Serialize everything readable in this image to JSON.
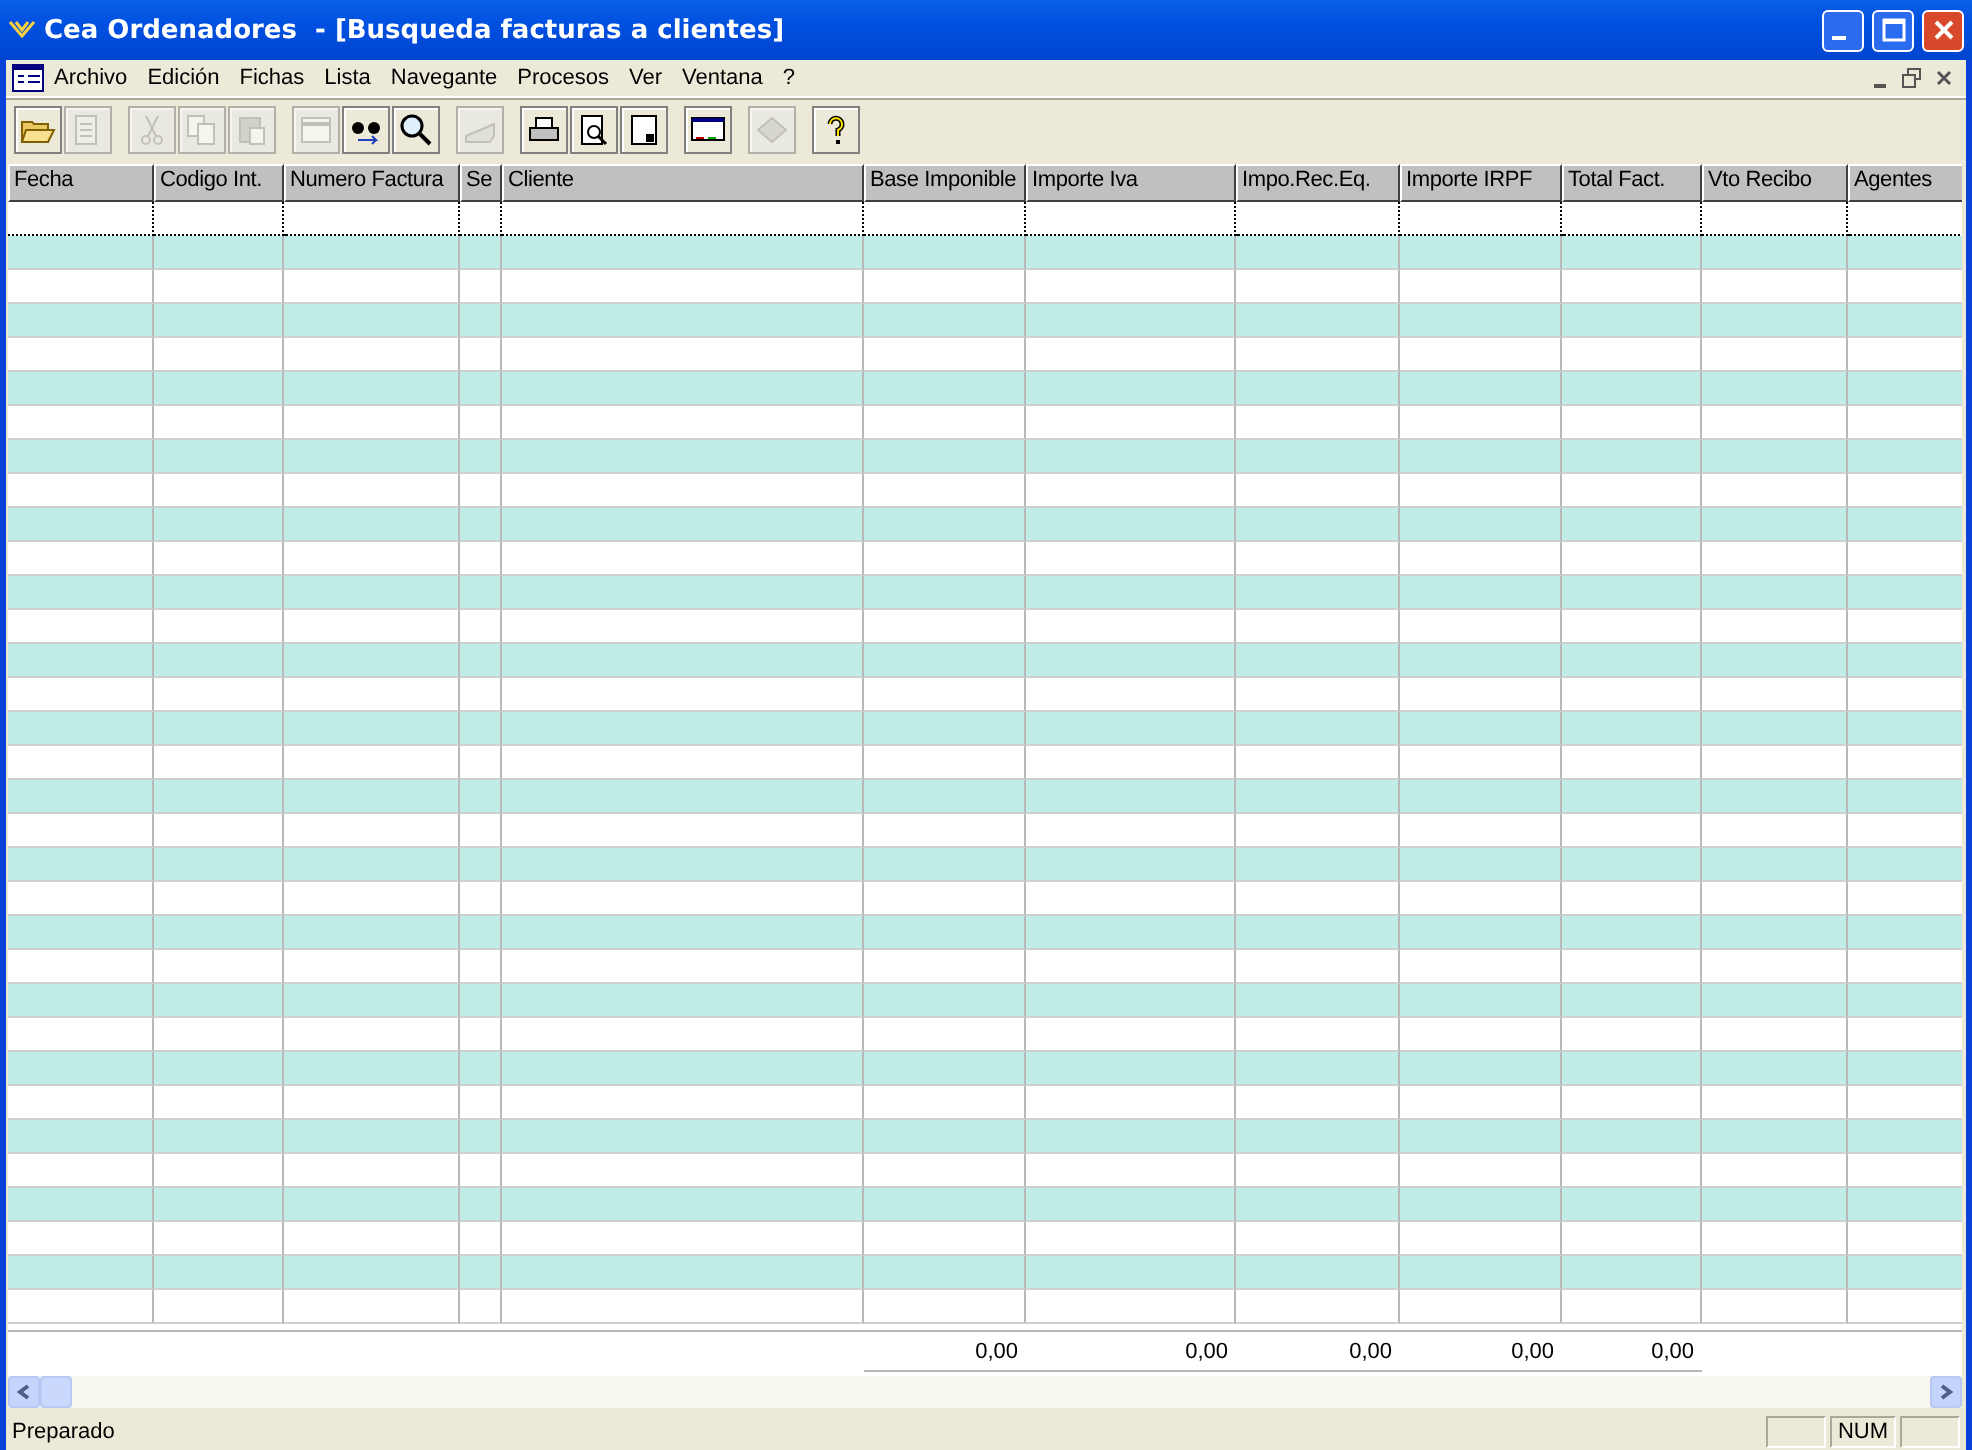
{
  "window": {
    "title": "Cea Ordenadores  - [Busqueda facturas a clientes]"
  },
  "menu": [
    "Archivo",
    "Edición",
    "Fichas",
    "Lista",
    "Navegante",
    "Procesos",
    "Ver",
    "Ventana",
    "?"
  ],
  "toolbar": [
    [
      {
        "kind": "open",
        "disabled": false
      },
      {
        "kind": "edit",
        "disabled": true
      }
    ],
    [
      {
        "kind": "cut",
        "disabled": true
      },
      {
        "kind": "copy",
        "disabled": true
      },
      {
        "kind": "paste",
        "disabled": true
      }
    ],
    [
      {
        "kind": "window",
        "disabled": true
      },
      {
        "kind": "binoculars",
        "disabled": false
      },
      {
        "kind": "magnifier",
        "disabled": false
      }
    ],
    [
      {
        "kind": "scanner",
        "disabled": true
      }
    ],
    [
      {
        "kind": "printer",
        "disabled": false
      },
      {
        "kind": "preview",
        "disabled": false
      },
      {
        "kind": "page",
        "disabled": false
      }
    ],
    [
      {
        "kind": "monitor",
        "disabled": false
      }
    ],
    [
      {
        "kind": "eraser",
        "disabled": true
      }
    ],
    [
      {
        "kind": "help",
        "disabled": false
      }
    ]
  ],
  "table": {
    "columns": [
      {
        "label": "Fecha"
      },
      {
        "label": "Codigo Int."
      },
      {
        "label": "Numero Factura"
      },
      {
        "label": "Se"
      },
      {
        "label": "Cliente"
      },
      {
        "label": "Base Imponible",
        "total": "0,00"
      },
      {
        "label": "Importe Iva",
        "total": "0,00"
      },
      {
        "label": "Impo.Rec.Eq.",
        "total": "0,00"
      },
      {
        "label": "Importe IRPF",
        "total": "0,00"
      },
      {
        "label": "Total Fact.",
        "total": "0,00"
      },
      {
        "label": "Vto Recibo"
      },
      {
        "label": "Agentes"
      }
    ]
  },
  "status_bar": {
    "message": "Preparado",
    "indicator": "NUM"
  }
}
